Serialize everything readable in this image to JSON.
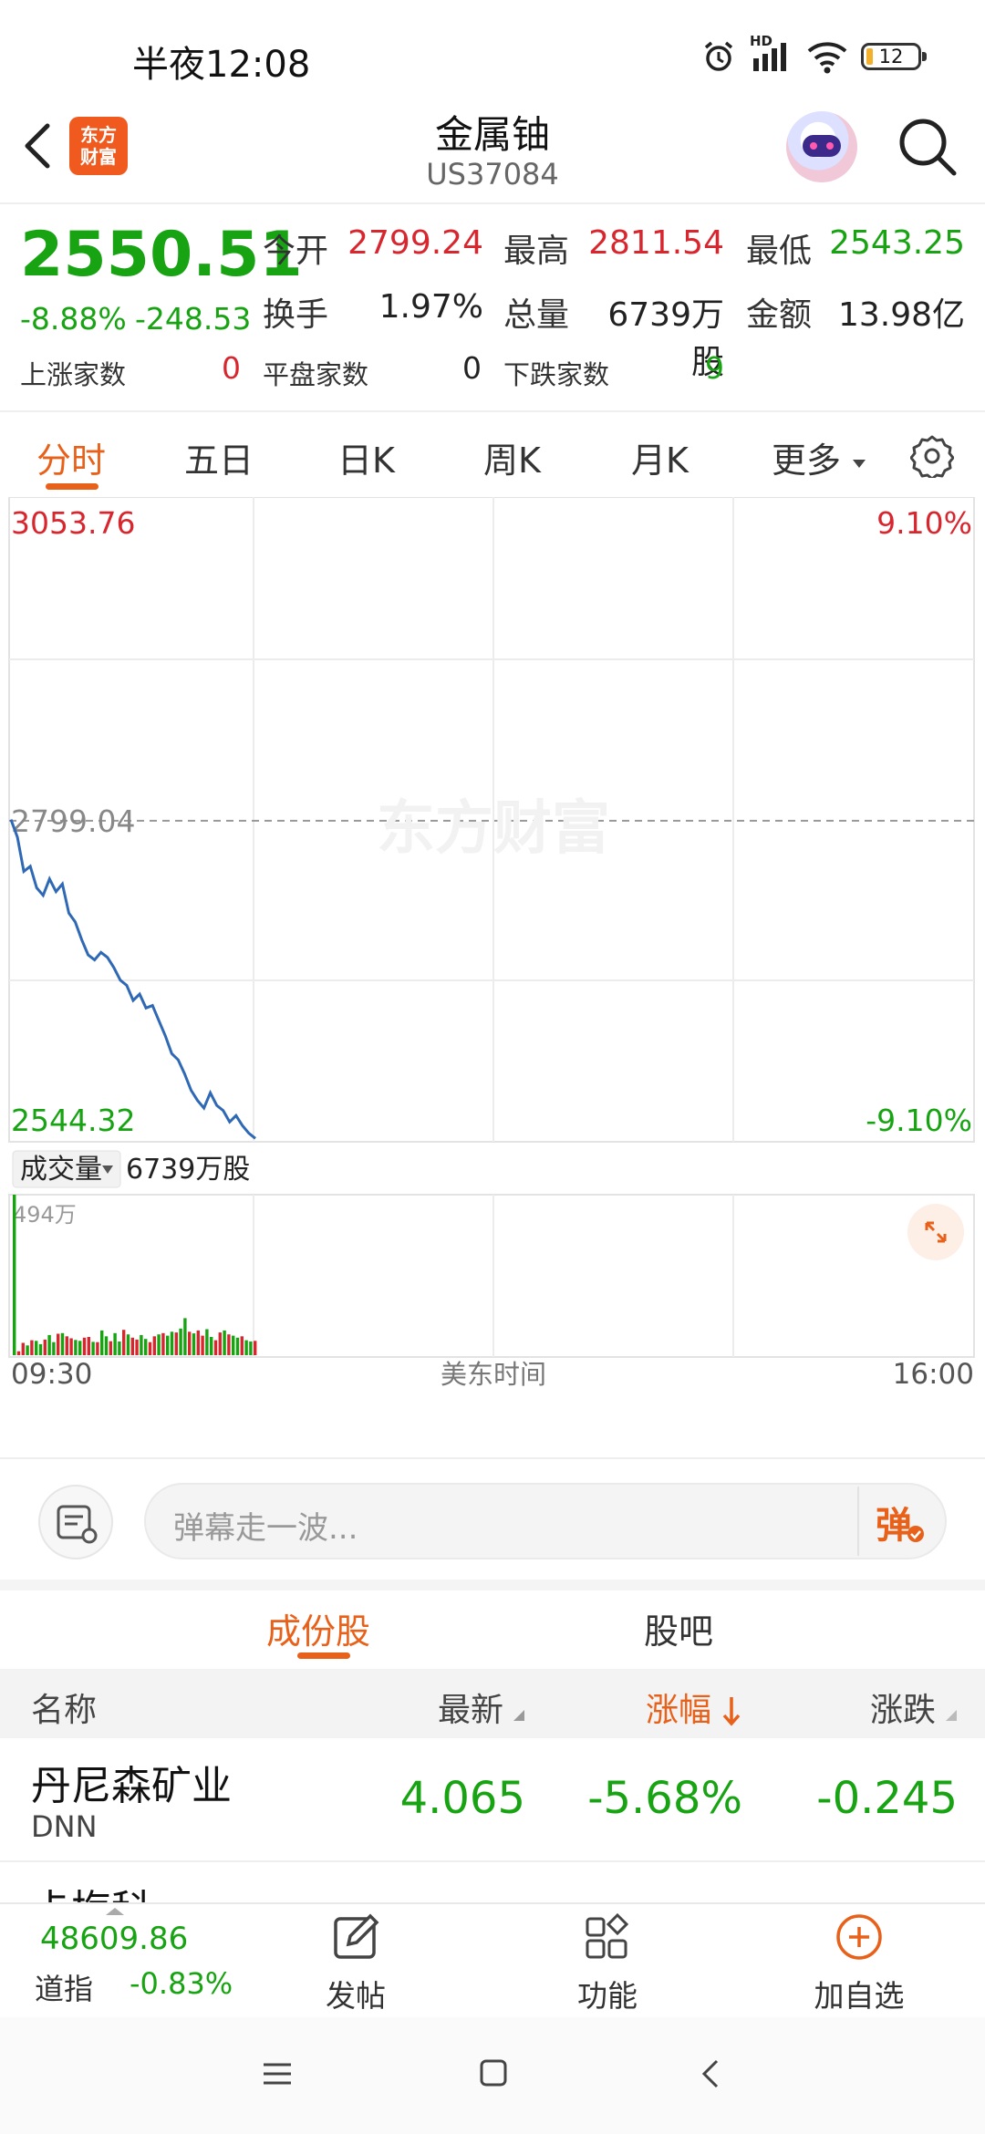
{
  "status_bar": {
    "time": "半夜12:08",
    "battery": "12",
    "network_label": "HD"
  },
  "header": {
    "title": "金属铀",
    "code": "US37084",
    "logo_text_1": "东方",
    "logo_text_2": "财富"
  },
  "quote": {
    "price": "2550.51",
    "change_pct": "-8.88%",
    "change_amt": "-248.53",
    "open_label": "今开",
    "open": "2799.24",
    "high_label": "最高",
    "high": "2811.54",
    "low_label": "最低",
    "low": "2543.25",
    "turnover_label": "换手",
    "turnover": "1.97%",
    "volume_label": "总量",
    "volume": "6739万股",
    "amount_label": "金额",
    "amount": "13.98亿",
    "up_label": "上涨家数",
    "up": "0",
    "flat_label": "平盘家数",
    "flat": "0",
    "down_label": "下跌家数",
    "down": "9"
  },
  "period_tabs": [
    "分时",
    "五日",
    "日K",
    "周K",
    "月K",
    "更多"
  ],
  "chart": {
    "watermark": "东方财富",
    "price_high": "3053.76",
    "price_prev": "2799.04",
    "price_low": "2544.32",
    "pct_high": "9.10%",
    "pct_low": "-9.10%",
    "volume_selector": "成交量",
    "volume_total": "6739万股",
    "volume_max": "494万",
    "time_start": "09:30",
    "time_zone": "美东时间",
    "time_end": "16:00"
  },
  "chart_data": {
    "type": "line",
    "title": "",
    "xlabel": "美东时间",
    "ylabel": "",
    "x_range": [
      "09:30",
      "16:00"
    ],
    "ylim": [
      2544.32,
      3053.76
    ],
    "reference_line": 2799.04,
    "series": [
      {
        "values": [
          2799,
          2785,
          2758,
          2762,
          2745,
          2739,
          2752,
          2742,
          2748,
          2725,
          2718,
          2704,
          2692,
          2688,
          2694,
          2690,
          2682,
          2672,
          2668,
          2656,
          2661,
          2650,
          2652,
          2640,
          2628,
          2614,
          2609,
          2598,
          2585,
          2577,
          2571,
          2583,
          2573,
          2569,
          2560,
          2565,
          2557,
          2551,
          2547
        ]
      }
    ],
    "volume": {
      "max_label": "494万",
      "values": [
        494,
        12,
        38,
        30,
        46,
        44,
        34,
        48,
        62,
        40,
        66,
        68,
        58,
        52,
        47,
        44,
        54,
        56,
        41,
        40,
        76,
        58,
        43,
        68,
        42,
        78,
        64,
        54,
        48,
        62,
        50,
        40,
        58,
        64,
        68,
        60,
        72,
        70,
        82,
        114,
        72,
        67,
        76,
        60,
        80,
        56,
        46,
        70,
        76,
        64,
        60,
        54,
        58,
        46,
        42,
        44
      ],
      "colors_up": "#d8262e",
      "colors_down": "#17a312"
    }
  },
  "comment_bar": {
    "placeholder": "弹幕走一波...",
    "danmu_button": "弹"
  },
  "lower_tabs": [
    "成份股",
    "股吧"
  ],
  "table": {
    "headers": [
      "名称",
      "最新",
      "涨幅",
      "涨跌"
    ],
    "rows": [
      {
        "name": "丹尼森矿业",
        "code": "DNN",
        "last": "4.065",
        "pct": "-5.68%",
        "chg": "-0.245"
      },
      {
        "name": "卡梅科"
      }
    ]
  },
  "bottom_bar": {
    "index_value": "48609.86",
    "index_name": "道指",
    "index_change": "-0.83%",
    "post_label": "发帖",
    "function_label": "功能",
    "add_label": "加自选"
  },
  "colors": {
    "up": "#d8262e",
    "down": "#17a312",
    "accent": "#e8611a",
    "line": "#2f68b5"
  }
}
